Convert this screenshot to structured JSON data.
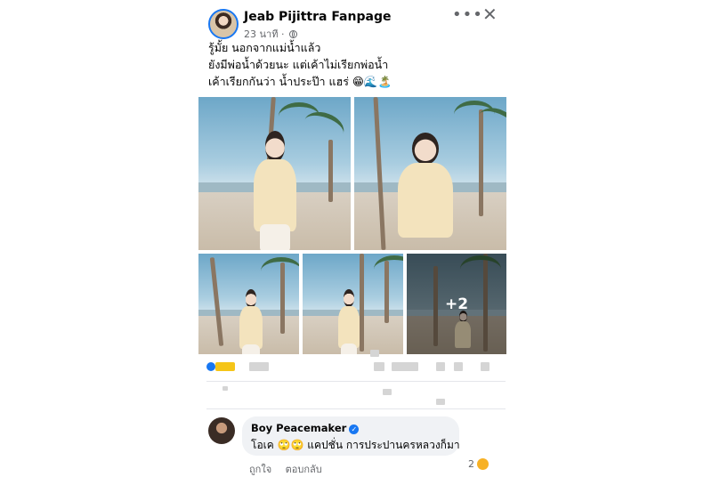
{
  "post": {
    "page_name": "Jeab Pijittra Fanpage",
    "time": "23 นาที",
    "caption_lines": [
      "รู้มั้ย นอกจากแม่น้ำแล้ว",
      "ยังมีพ่อน้ำด้วยนะ แต่เค้าไม่เรียกพ่อน้ำ",
      "เค้าเรียกกันว่า น้ำประป๊า แฮร่ 😁🌊🏝️"
    ],
    "more_photos_label": "+2",
    "icons": [
      "more-icon",
      "close-icon",
      "globe-icon"
    ]
  },
  "comment": {
    "author": "Boy Peacemaker",
    "text": "โอเค 🙄🙄 แคปชั่น การประปานครหลวงก็มา",
    "like_label": "ถูกใจ",
    "reply_label": "ตอบกลับ",
    "reaction_count": "2"
  },
  "colors": {
    "accent": "#1877f2",
    "muted_text": "#65676b",
    "bubble": "#f0f2f5"
  }
}
